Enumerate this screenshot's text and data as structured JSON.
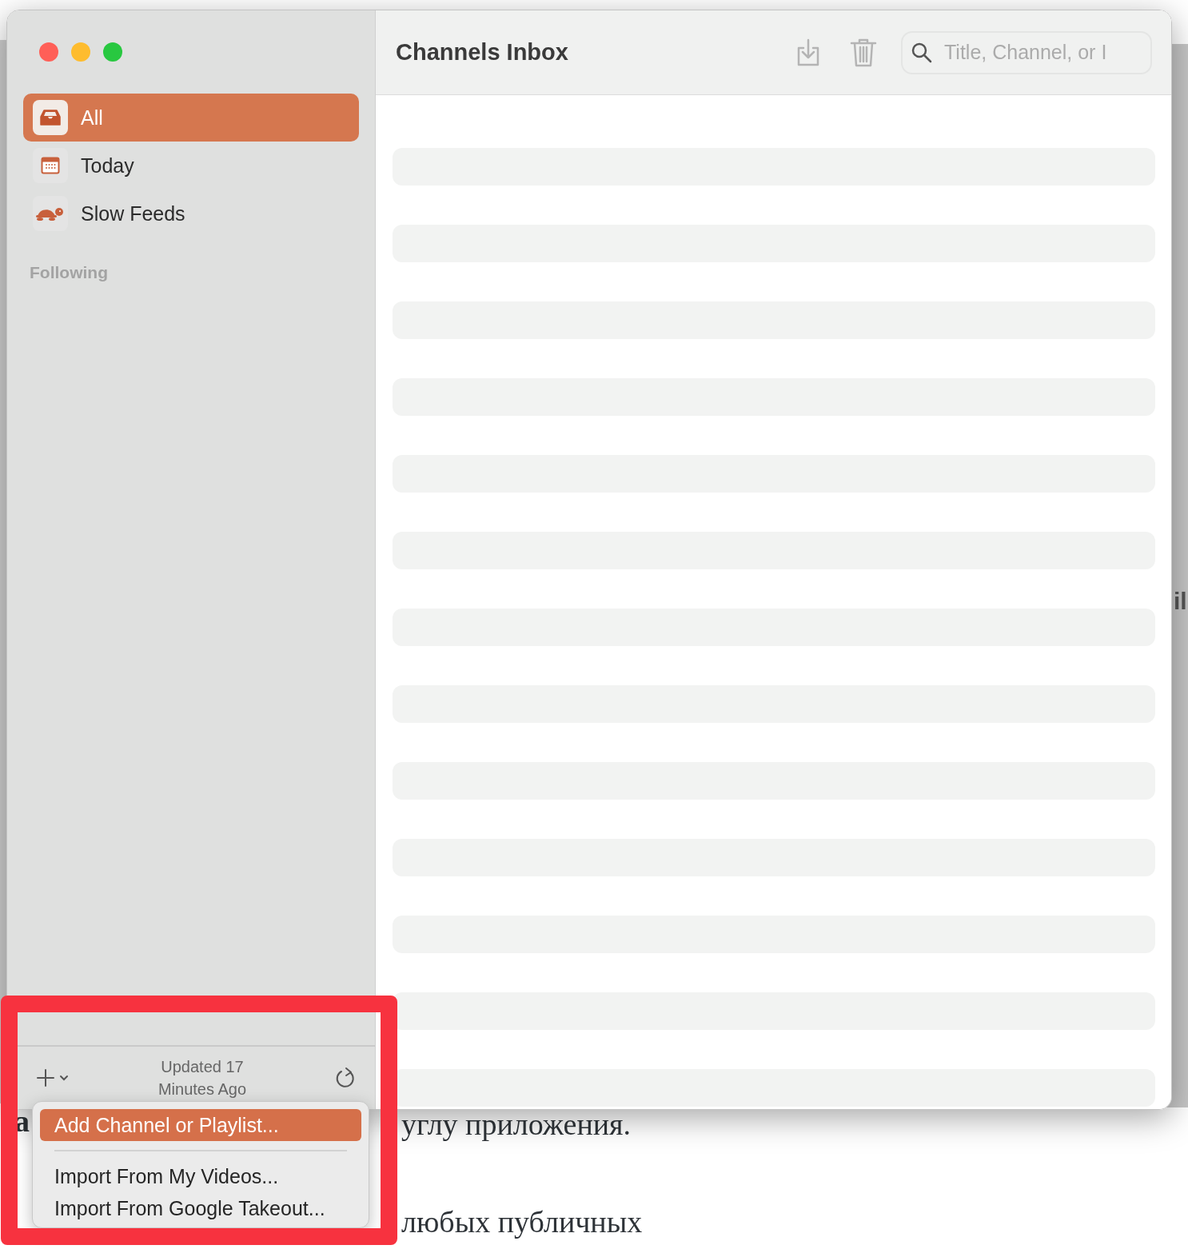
{
  "background_page": {
    "side_fragment": "il",
    "bold_fragment": "а",
    "line_fragment": "углу приложения.",
    "bottom_fragment": "любых публичных"
  },
  "window": {
    "traffic_lights": [
      {
        "color": "#ff5f57"
      },
      {
        "color": "#febc2e"
      },
      {
        "color": "#28c840"
      }
    ],
    "title": "Channels Inbox",
    "search": {
      "placeholder": "Title, Channel, or I"
    }
  },
  "sidebar": {
    "items": [
      {
        "label": "All",
        "kind": "inbox",
        "selected": true
      },
      {
        "label": "Today",
        "kind": "calendar",
        "selected": false
      },
      {
        "label": "Slow Feeds",
        "kind": "turtle",
        "selected": false
      }
    ],
    "section_heading": "Following",
    "status": "Updated 17 Minutes Ago"
  },
  "menu": {
    "items": [
      {
        "kind": "item",
        "label": "Add Channel or Playlist...",
        "selected": true
      },
      {
        "kind": "separator"
      },
      {
        "kind": "item",
        "label": "Import From My Videos...",
        "selected": false
      },
      {
        "kind": "item",
        "label": "Import From Google Takeout...",
        "selected": false
      }
    ]
  }
}
